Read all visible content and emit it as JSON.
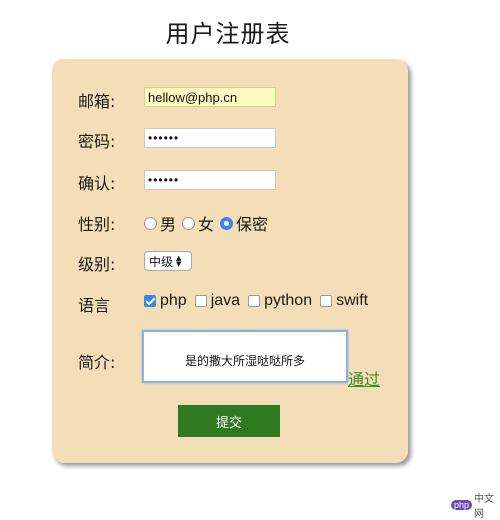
{
  "page": {
    "title": "用户注册表"
  },
  "form": {
    "email": {
      "label": "邮箱:",
      "value": "hellow@php.cn"
    },
    "password": {
      "label": "密码:",
      "value": "••••••"
    },
    "confirm": {
      "label": "确认:",
      "value": "••••••"
    },
    "gender": {
      "label": "性别:",
      "options": [
        {
          "label": "男",
          "checked": false
        },
        {
          "label": "女",
          "checked": false
        },
        {
          "label": "保密",
          "checked": true
        }
      ]
    },
    "level": {
      "label": "级别:",
      "selected": "中级"
    },
    "language": {
      "label": "语言",
      "options": [
        {
          "label": "php",
          "checked": true
        },
        {
          "label": "java",
          "checked": false
        },
        {
          "label": "python",
          "checked": false
        },
        {
          "label": "swift",
          "checked": false
        }
      ]
    },
    "intro": {
      "label": "简介:",
      "value": "是的撒大所湿哒哒所多"
    },
    "link_text": "通过",
    "submit_label": "提交"
  },
  "watermark": {
    "logo": "php",
    "text": "中文网"
  },
  "colors": {
    "card_bg": "#f4deb7",
    "submit_bg": "#2f7a20",
    "accent_blue": "#3a86e8",
    "link_green": "#3a8a2a",
    "autofill_bg": "#fbfbc2"
  }
}
